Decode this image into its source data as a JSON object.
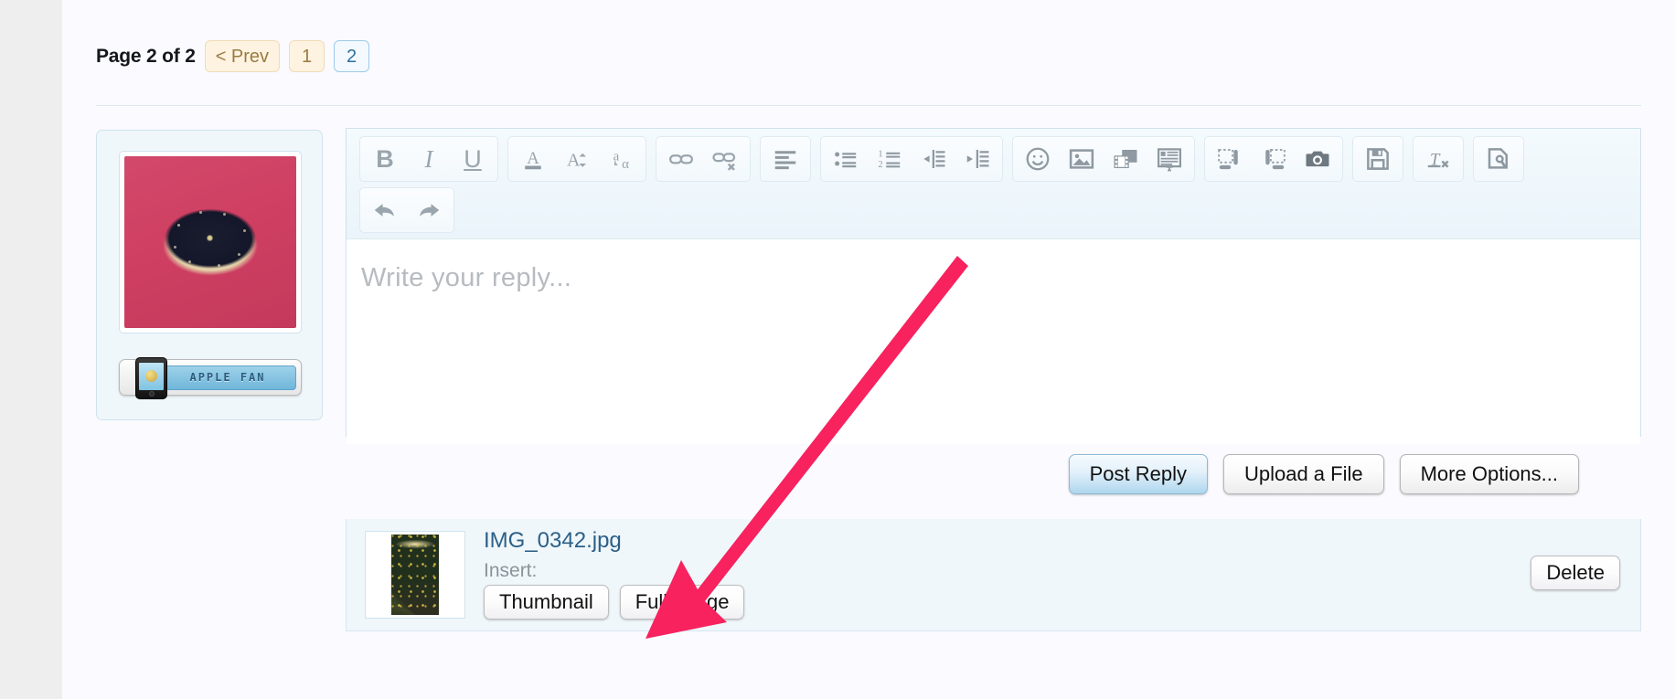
{
  "pagination": {
    "label": "Page 2 of 2",
    "prev_label": "< Prev",
    "pages": [
      "1",
      "2"
    ],
    "current_page": "2"
  },
  "user_card": {
    "avatar_alt": "user-avatar-photo",
    "badge_label": "APPLE FAN"
  },
  "editor": {
    "placeholder": "Write your reply...",
    "content": "",
    "toolbar_rows": [
      {
        "groups": [
          {
            "buttons": [
              {
                "name": "bold-icon",
                "label": "B"
              },
              {
                "name": "italic-icon",
                "label": "I"
              },
              {
                "name": "underline-icon",
                "label": "U"
              }
            ]
          },
          {
            "buttons": [
              {
                "name": "text-color-icon",
                "label": "A"
              },
              {
                "name": "font-size-icon",
                "label": "A÷"
              },
              {
                "name": "font-family-icon",
                "label": "aα"
              }
            ]
          },
          {
            "buttons": [
              {
                "name": "insert-link-icon",
                "label": "link"
              },
              {
                "name": "unlink-icon",
                "label": "unlink"
              }
            ]
          },
          {
            "buttons": [
              {
                "name": "align-icon",
                "label": "align"
              }
            ]
          },
          {
            "buttons": [
              {
                "name": "bullet-list-icon",
                "label": "bullets"
              },
              {
                "name": "numbered-list-icon",
                "label": "numbers"
              },
              {
                "name": "outdent-icon",
                "label": "outdent"
              },
              {
                "name": "indent-icon",
                "label": "indent"
              }
            ]
          },
          {
            "buttons": [
              {
                "name": "smilie-icon",
                "label": "smilie"
              },
              {
                "name": "insert-image-icon",
                "label": "image"
              },
              {
                "name": "insert-media-icon",
                "label": "media"
              },
              {
                "name": "insert-quote-icon",
                "label": "quote"
              }
            ]
          },
          {
            "buttons": [
              {
                "name": "float-left-icon",
                "label": "float left"
              },
              {
                "name": "float-right-icon",
                "label": "float right"
              },
              {
                "name": "camera-icon",
                "label": "camera"
              }
            ]
          },
          {
            "buttons": [
              {
                "name": "save-draft-icon",
                "label": "save draft"
              }
            ]
          },
          {
            "buttons": [
              {
                "name": "remove-format-icon",
                "label": "remove format"
              }
            ]
          },
          {
            "buttons": [
              {
                "name": "source-code-icon",
                "label": "source"
              }
            ]
          }
        ]
      },
      {
        "groups": [
          {
            "buttons": [
              {
                "name": "undo-icon",
                "label": "undo"
              },
              {
                "name": "redo-icon",
                "label": "redo"
              }
            ]
          }
        ]
      }
    ]
  },
  "actions": {
    "post_reply": "Post Reply",
    "upload_a_file": "Upload a File",
    "more_options": "More Options..."
  },
  "attachment": {
    "filename": "IMG_0342.jpg",
    "insert_label": "Insert:",
    "thumbnail_button": "Thumbnail",
    "full_image_button": "Full Image",
    "delete_button": "Delete",
    "thumb_alt": "christmas-tree-photo"
  },
  "annotation": {
    "arrow_color": "#f7225e",
    "points_to": "full-image-button"
  },
  "colors": {
    "page_background": "#fafaff",
    "gutter": "#eeeeee",
    "panel": "#eff7fb",
    "panel_border": "#cfe3ee",
    "link": "#2c5f87",
    "pager_tan_bg": "#fdf3e0",
    "pager_tan_text": "#9b7a42",
    "pager_active_border": "#9ecbe8"
  }
}
